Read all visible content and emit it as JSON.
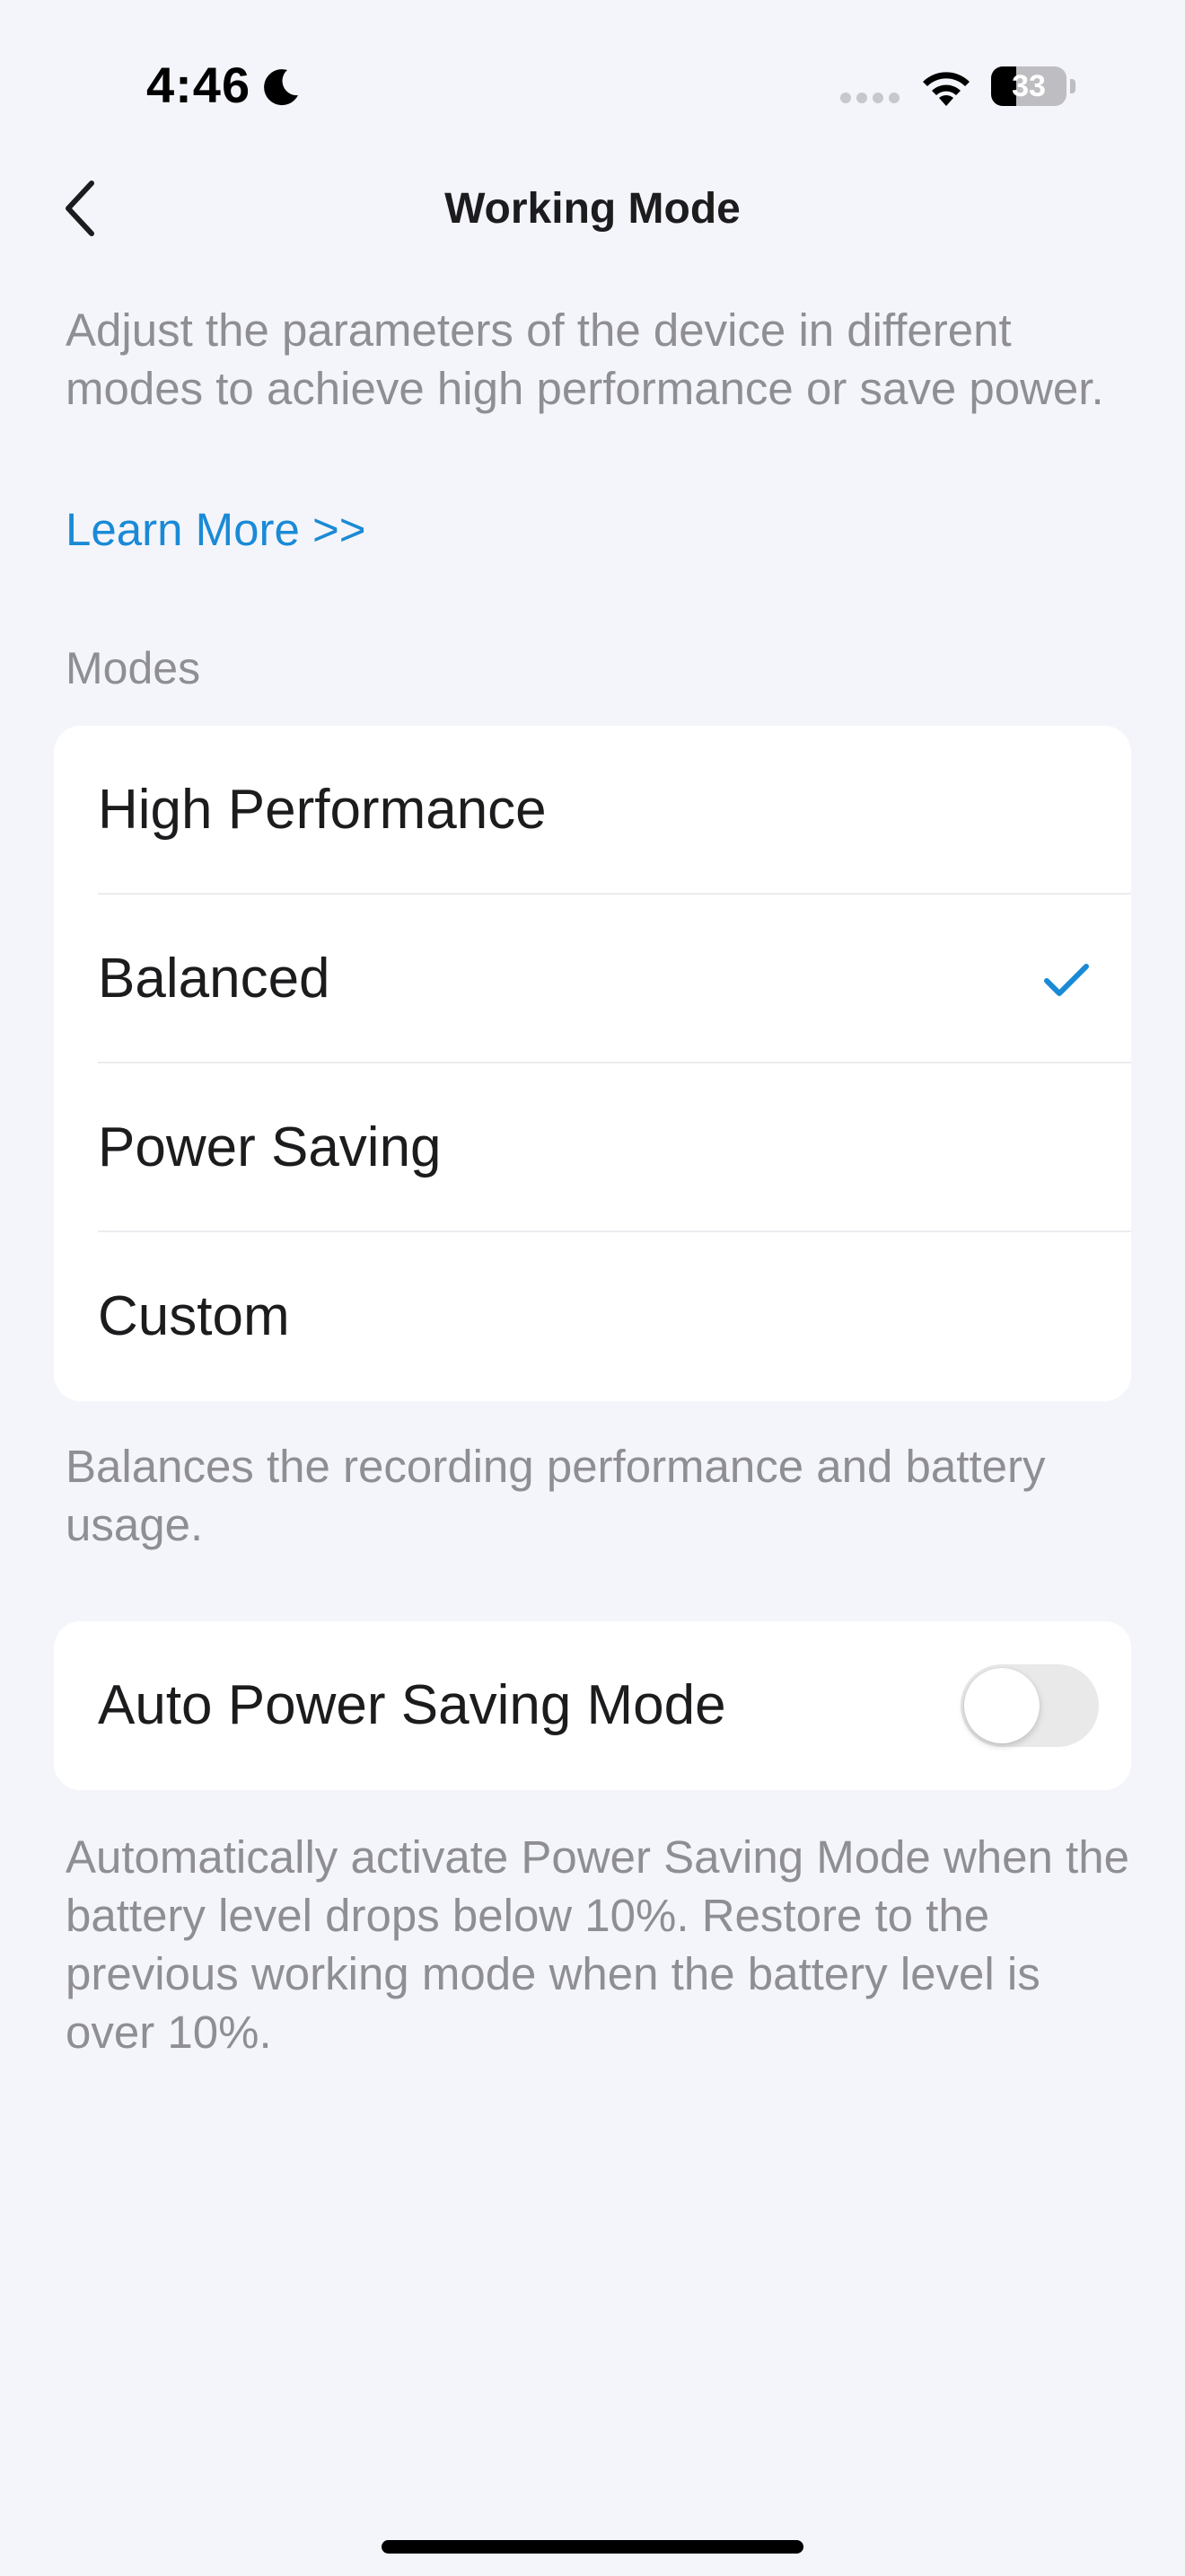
{
  "status_bar": {
    "time": "4:46",
    "battery_level": "33",
    "battery_fraction": 0.33,
    "icons": [
      "moon-icon",
      "signal-icon",
      "wifi-icon",
      "battery-icon"
    ]
  },
  "nav": {
    "back_icon": "chevron-left-icon",
    "title": "Working Mode"
  },
  "intro": {
    "text": "Adjust the parameters of the device in different modes to achieve high performance or save power.",
    "learn_more": "Learn More >>"
  },
  "modes": {
    "section_label": "Modes",
    "items": [
      {
        "label": "High Performance",
        "selected": false
      },
      {
        "label": "Balanced",
        "selected": true
      },
      {
        "label": "Power Saving",
        "selected": false
      },
      {
        "label": "Custom",
        "selected": false
      }
    ],
    "description": "Balances the recording performance and battery usage."
  },
  "auto_power_saving": {
    "label": "Auto Power Saving Mode",
    "enabled": false,
    "description": "Automatically activate Power Saving Mode when the battery level drops below 10%. Restore to the previous working mode when the battery level is over 10%."
  },
  "colors": {
    "accent": "#1a8ad6",
    "background": "#f4f5fa",
    "secondary_text": "#8e8e93",
    "toggle_off": "#e9e9ea"
  }
}
